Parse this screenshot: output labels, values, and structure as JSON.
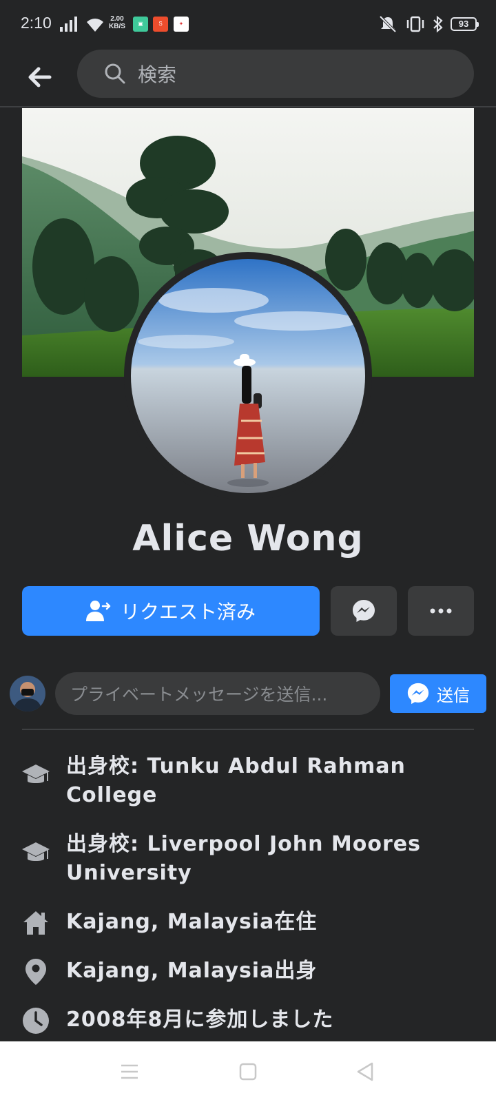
{
  "status_bar": {
    "time": "2:10",
    "net_speed_value": "2.00",
    "net_speed_unit": "KB/S",
    "battery": "93",
    "icons": [
      "signal-icon",
      "wifi-icon",
      "app-icon",
      "shopee-icon",
      "app-icon",
      "mute-icon",
      "vibrate-icon",
      "bluetooth-icon",
      "battery-icon"
    ]
  },
  "top_bar": {
    "search_placeholder": "検索"
  },
  "profile": {
    "name": "Alice Wong"
  },
  "actions": {
    "request_label": "リクエスト済み",
    "messenger_icon": "messenger-icon",
    "more_icon": "more-icon"
  },
  "message": {
    "placeholder": "プライベートメッセージを送信...",
    "send_label": "送信"
  },
  "info": [
    {
      "icon": "graduation-cap-icon",
      "text": "出身校: Tunku Abdul Rahman College"
    },
    {
      "icon": "graduation-cap-icon",
      "text": "出身校: Liverpool John Moores University"
    },
    {
      "icon": "home-icon",
      "text": "Kajang, Malaysia在住"
    },
    {
      "icon": "location-pin-icon",
      "text": "Kajang, Malaysia出身"
    },
    {
      "icon": "clock-icon",
      "text": "2008年8月に参加しました"
    }
  ],
  "colors": {
    "background": "#242526",
    "accent": "#2d88ff",
    "surface": "#3a3b3c",
    "text": "#e4e6eb",
    "muted": "#b0b3b8"
  }
}
